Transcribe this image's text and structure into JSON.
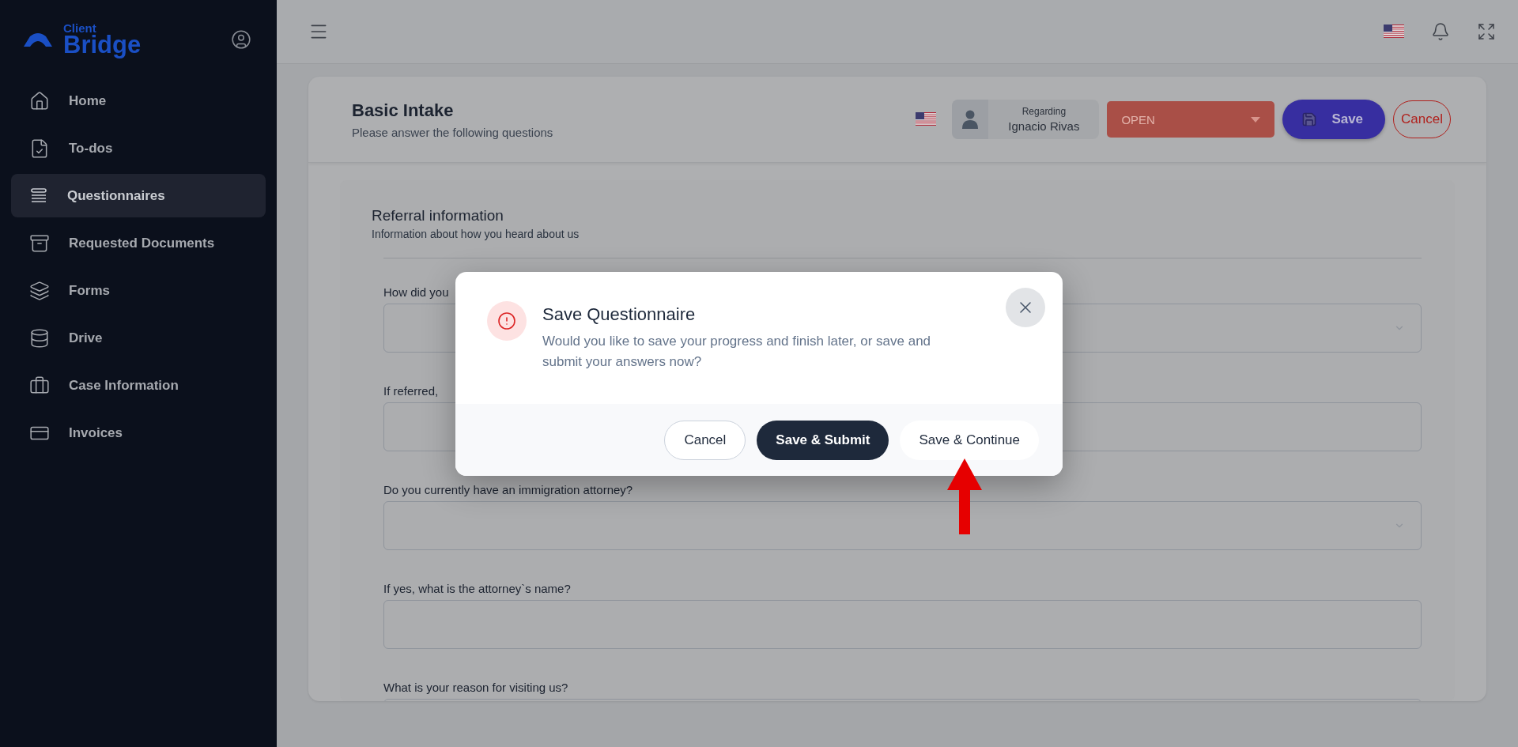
{
  "sidebar": {
    "logo": {
      "small": "Client",
      "large": "Bridge"
    },
    "items": [
      {
        "label": "Home",
        "selected": false
      },
      {
        "label": "To-dos",
        "selected": false
      },
      {
        "label": "Questionnaires",
        "selected": true
      },
      {
        "label": "Requested Documents",
        "selected": false
      },
      {
        "label": "Forms",
        "selected": false
      },
      {
        "label": "Drive",
        "selected": false
      },
      {
        "label": "Case Information",
        "selected": false
      },
      {
        "label": "Invoices",
        "selected": false
      }
    ]
  },
  "page": {
    "title": "Basic Intake",
    "subtitle": "Please answer the following questions",
    "regarding": {
      "label": "Regarding",
      "name": "Ignacio Rivas"
    },
    "status": "OPEN",
    "buttons": [
      {
        "label": "Save",
        "kind": "primary"
      },
      {
        "label": "Cancel",
        "kind": "outline"
      }
    ]
  },
  "section": {
    "title": "Referral information",
    "subtitle": "Information about how you heard about us",
    "questions": [
      {
        "label": "How did you",
        "kind": "select"
      },
      {
        "label": "If referred,",
        "kind": "text"
      },
      {
        "label": "Do you currently have an immigration attorney?",
        "kind": "select"
      },
      {
        "label": "If yes, what is the attorney`s name?",
        "kind": "text"
      },
      {
        "label": "What is your reason for visiting us?",
        "kind": "text"
      }
    ]
  },
  "dialog": {
    "title": "Save Questionnaire",
    "message": "Would you like to save your progress and finish later, or save and submit your answers now?",
    "buttons": [
      {
        "label": "Cancel",
        "kind": "secondary"
      },
      {
        "label": "Save & Submit",
        "kind": "dark"
      },
      {
        "label": "Save & Continue",
        "kind": "plain"
      }
    ]
  }
}
